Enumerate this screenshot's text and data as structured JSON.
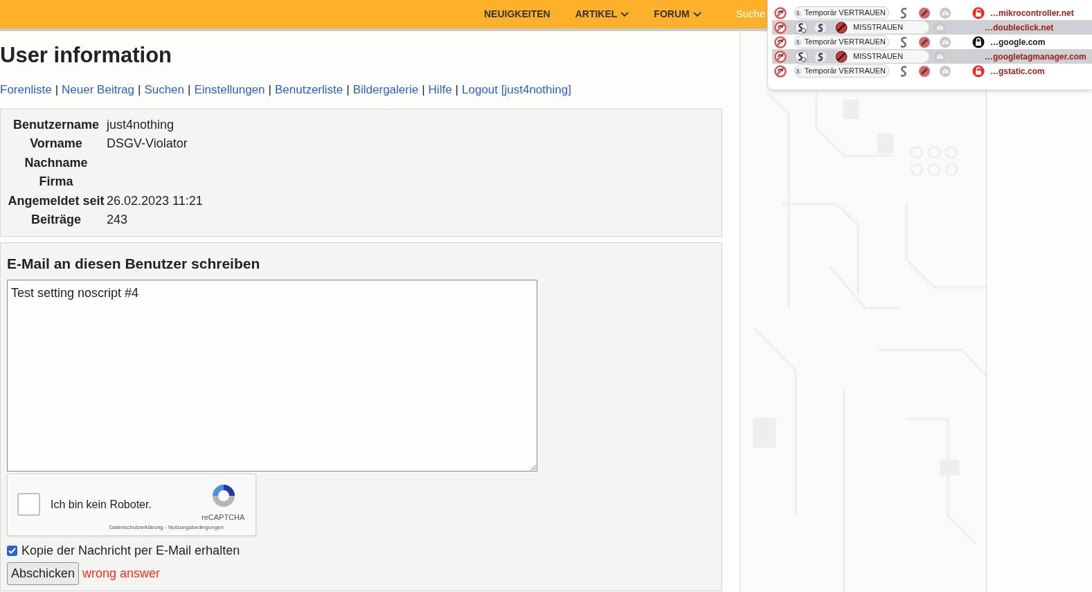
{
  "nav": [
    {
      "label": "NEUIGKEITEN",
      "dropdown": false
    },
    {
      "label": "ARTIKEL",
      "dropdown": true
    },
    {
      "label": "FORUM",
      "dropdown": true
    }
  ],
  "search_label": "Suche",
  "title": "User information",
  "link_separator": "|",
  "links": [
    "Forenliste",
    "Neuer Beitrag",
    "Suchen",
    "Einstellungen",
    "Benutzerliste",
    "Bildergalerie",
    "Hilfe",
    "Logout [just4nothing]"
  ],
  "user_info": [
    {
      "label": "Benutzername",
      "value": "just4nothing"
    },
    {
      "label": "Vorname",
      "value": "DSGV-Violator"
    },
    {
      "label": "Nachname"
    },
    {
      "label": "Firma"
    },
    {
      "label": "Angemeldet seit",
      "value": "26.02.2023 11:21"
    },
    {
      "label": "Beiträge",
      "value": "243"
    }
  ],
  "email": {
    "heading": "E-Mail an diesen Benutzer schreiben",
    "message": "Test setting noscript #4",
    "captcha": {
      "checked": false,
      "label": "Ich bin kein Roboter.",
      "brand": "reCAPTCHA",
      "footer": "Datenschutzerklärung - Nutzungsbedingungen"
    },
    "copy": {
      "checked": true,
      "label": "Kopie der Nachricht per E-Mail erhalten"
    },
    "submit": "Abschicken",
    "error": "wrong answer"
  },
  "noscript": [
    {
      "kind": "temp_trust",
      "label": "Temporär VERTRAUEN",
      "secure": false,
      "domain": "…mikrocontroller.net",
      "color": "#9b1c1c"
    },
    {
      "kind": "untrusted",
      "label": "MISSTRAUEN",
      "domain": "…doubleclick.net",
      "color": "#9b1c1c"
    },
    {
      "kind": "temp_trust",
      "label": "Temporär VERTRAUEN",
      "secure": true,
      "domain": "…google.com",
      "color": "#222222"
    },
    {
      "kind": "untrusted",
      "label": "MISSTRAUEN",
      "domain": "…googletagmanager.com",
      "color": "#9b1c1c"
    },
    {
      "kind": "temp_trust",
      "label": "Temporär VERTRAUEN",
      "secure": false,
      "domain": "…gstatic.com",
      "color": "#9b1c1c"
    }
  ]
}
